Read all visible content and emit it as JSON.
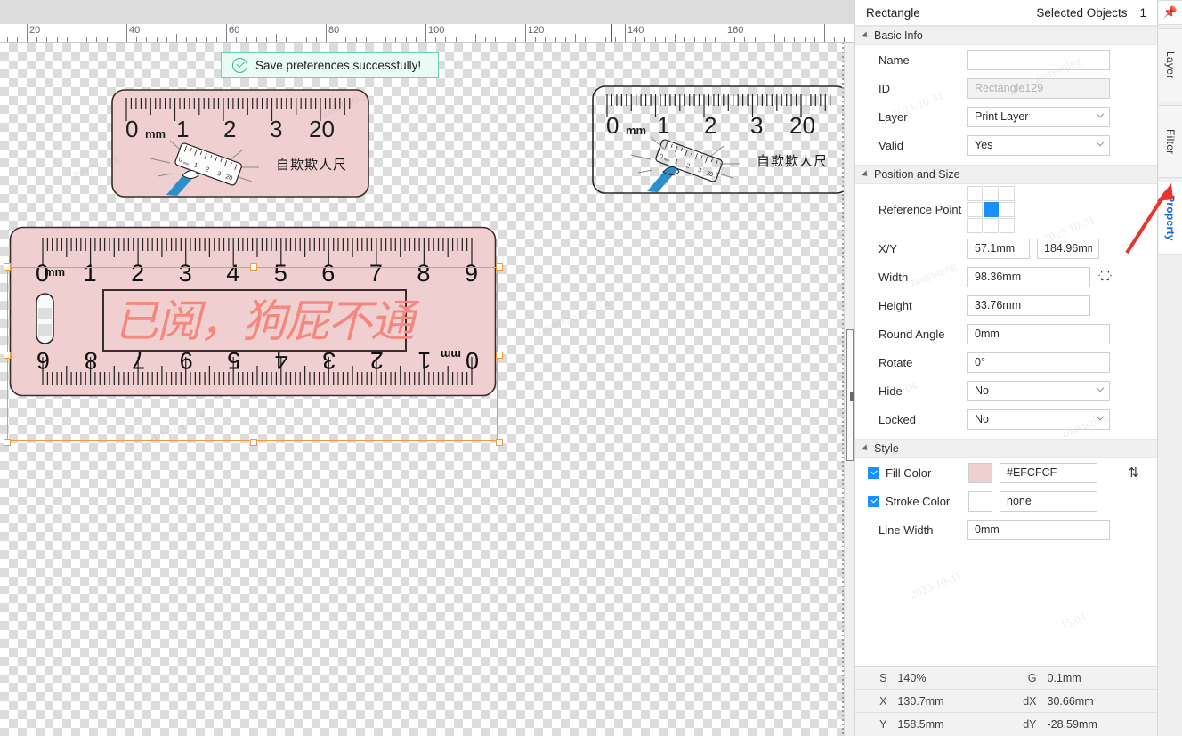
{
  "toast": {
    "message": "Save preferences successfully!",
    "icon": "check-circle-icon",
    "accent": "#2bbd8c",
    "bg": "#e9fbf4"
  },
  "ruler_bar": {
    "unit_labels": [
      "20",
      "40",
      "60",
      "80",
      "100",
      "120",
      "140",
      "160"
    ],
    "cursor_position": "130.7"
  },
  "canvas": {
    "objects": [
      {
        "name": "ruler-art-filled-small",
        "fill": "#EFCFCF",
        "numbers": [
          "0",
          "1",
          "2",
          "3",
          "20"
        ],
        "unit": "mm",
        "caption": "自欺欺人尺"
      },
      {
        "name": "ruler-art-outline-small",
        "fill": "none",
        "numbers": [
          "0",
          "1",
          "2",
          "3",
          "20"
        ],
        "unit": "mm",
        "caption": "自欺欺人尺"
      },
      {
        "name": "ruler-art-selected-large",
        "fill": "#EFCFCF",
        "unit": "mm",
        "numbers_top": [
          "0",
          "1",
          "2",
          "3",
          "4",
          "5",
          "6",
          "7",
          "8",
          "9"
        ],
        "numbers_bottom": [
          "6",
          "8",
          "7",
          "9",
          "5",
          "4",
          "3",
          "2",
          "1",
          "0"
        ],
        "stamp_text": "已阅，狗屁不通",
        "stamp_color": "#F5877F",
        "selected": true
      }
    ]
  },
  "panel": {
    "header": {
      "title": "Rectangle",
      "selected_label": "Selected Objects",
      "selected_count": "1",
      "pin_icon": "pin-icon"
    },
    "sections": {
      "basic_info": {
        "title": "Basic Info",
        "fields": {
          "name_label": "Name",
          "name_value": "",
          "id_label": "ID",
          "id_value": "Rectangle129",
          "layer_label": "Layer",
          "layer_value": "Print Layer",
          "valid_label": "Valid",
          "valid_value": "Yes"
        }
      },
      "position_and_size": {
        "title": "Position and Size",
        "fields": {
          "reference_point_label": "Reference Point",
          "reference_point_selected": "center",
          "xy_label": "X/Y",
          "x_value": "57.1mm",
          "y_value": "184.96mm",
          "width_label": "Width",
          "width_value": "98.36mm",
          "height_label": "Height",
          "height_value": "33.76mm",
          "round_angle_label": "Round Angle",
          "round_angle_value": "0mm",
          "rotate_label": "Rotate",
          "rotate_value": "0°",
          "hide_label": "Hide",
          "hide_value": "No",
          "locked_label": "Locked",
          "locked_value": "No",
          "link_icon": "aspect-ratio-link-icon"
        }
      },
      "style": {
        "title": "Style",
        "fields": {
          "fill_color_label": "Fill Color",
          "fill_color_checked": true,
          "fill_color_value": "#EFCFCF",
          "stroke_color_label": "Stroke Color",
          "stroke_color_checked": true,
          "stroke_color_value": "none",
          "line_width_label": "Line Width",
          "line_width_value": "0mm",
          "swap_icon": "swap-vertical-icon"
        }
      }
    },
    "status_bar": {
      "rows": [
        {
          "key": "S",
          "value": "140%",
          "key2": "G",
          "value2": "0.1mm"
        },
        {
          "key": "X",
          "value": "130.7mm",
          "key2": "dX",
          "value2": "30.66mm"
        },
        {
          "key": "Y",
          "value": "158.5mm",
          "key2": "dY",
          "value2": "-28.59mm"
        }
      ]
    }
  },
  "vertical_tabs": [
    {
      "label": "Layer",
      "active": false
    },
    {
      "label": "Filter",
      "active": false
    },
    {
      "label": "Property",
      "active": true
    }
  ],
  "colors": {
    "accent_blue": "#1890ff",
    "selection_orange": "#f29a3c",
    "active_tab_blue": "#1464d8"
  }
}
